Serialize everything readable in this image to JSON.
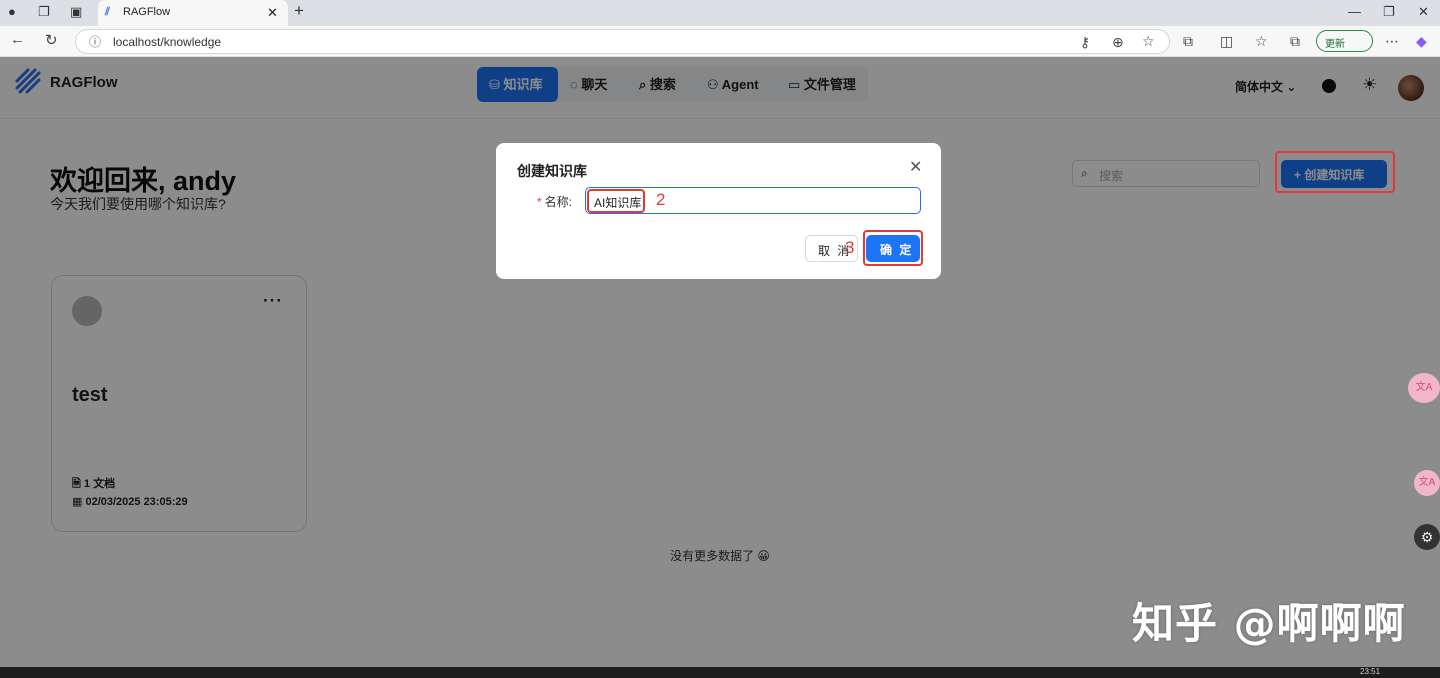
{
  "browser": {
    "tab_title": "RAGFlow",
    "url": "localhost/knowledge",
    "update_label": "更新"
  },
  "app": {
    "brand": "RAGFlow",
    "nav": [
      {
        "icon": "database-icon",
        "label": "知识库"
      },
      {
        "icon": "chat-icon",
        "label": "聊天"
      },
      {
        "icon": "search-icon",
        "label": "搜索"
      },
      {
        "icon": "agent-icon",
        "label": "Agent"
      },
      {
        "icon": "folder-icon",
        "label": "文件管理"
      }
    ],
    "language": "简体中文",
    "welcome": "欢迎回来, andy",
    "subtitle": "今天我们要使用哪个知识库?",
    "search_placeholder": "搜索",
    "create_label": "创建知识库",
    "card": {
      "name": "test",
      "doc_count": "1",
      "doc_unit": "文档",
      "created": "02/03/2025 23:05:29"
    },
    "no_more": "没有更多数据了 😀"
  },
  "modal": {
    "title": "创建知识库",
    "required_mark": "*",
    "name_label": "名称:",
    "name_value": "AI知识库",
    "cancel_label": "取 消",
    "ok_label": "确 定"
  },
  "annotations": {
    "step2": "2",
    "step3": "3"
  },
  "watermark": "知乎 @啊啊啊",
  "floating": {
    "translate1": "文A",
    "translate2": "文A"
  },
  "taskbar_time": "23:51"
}
